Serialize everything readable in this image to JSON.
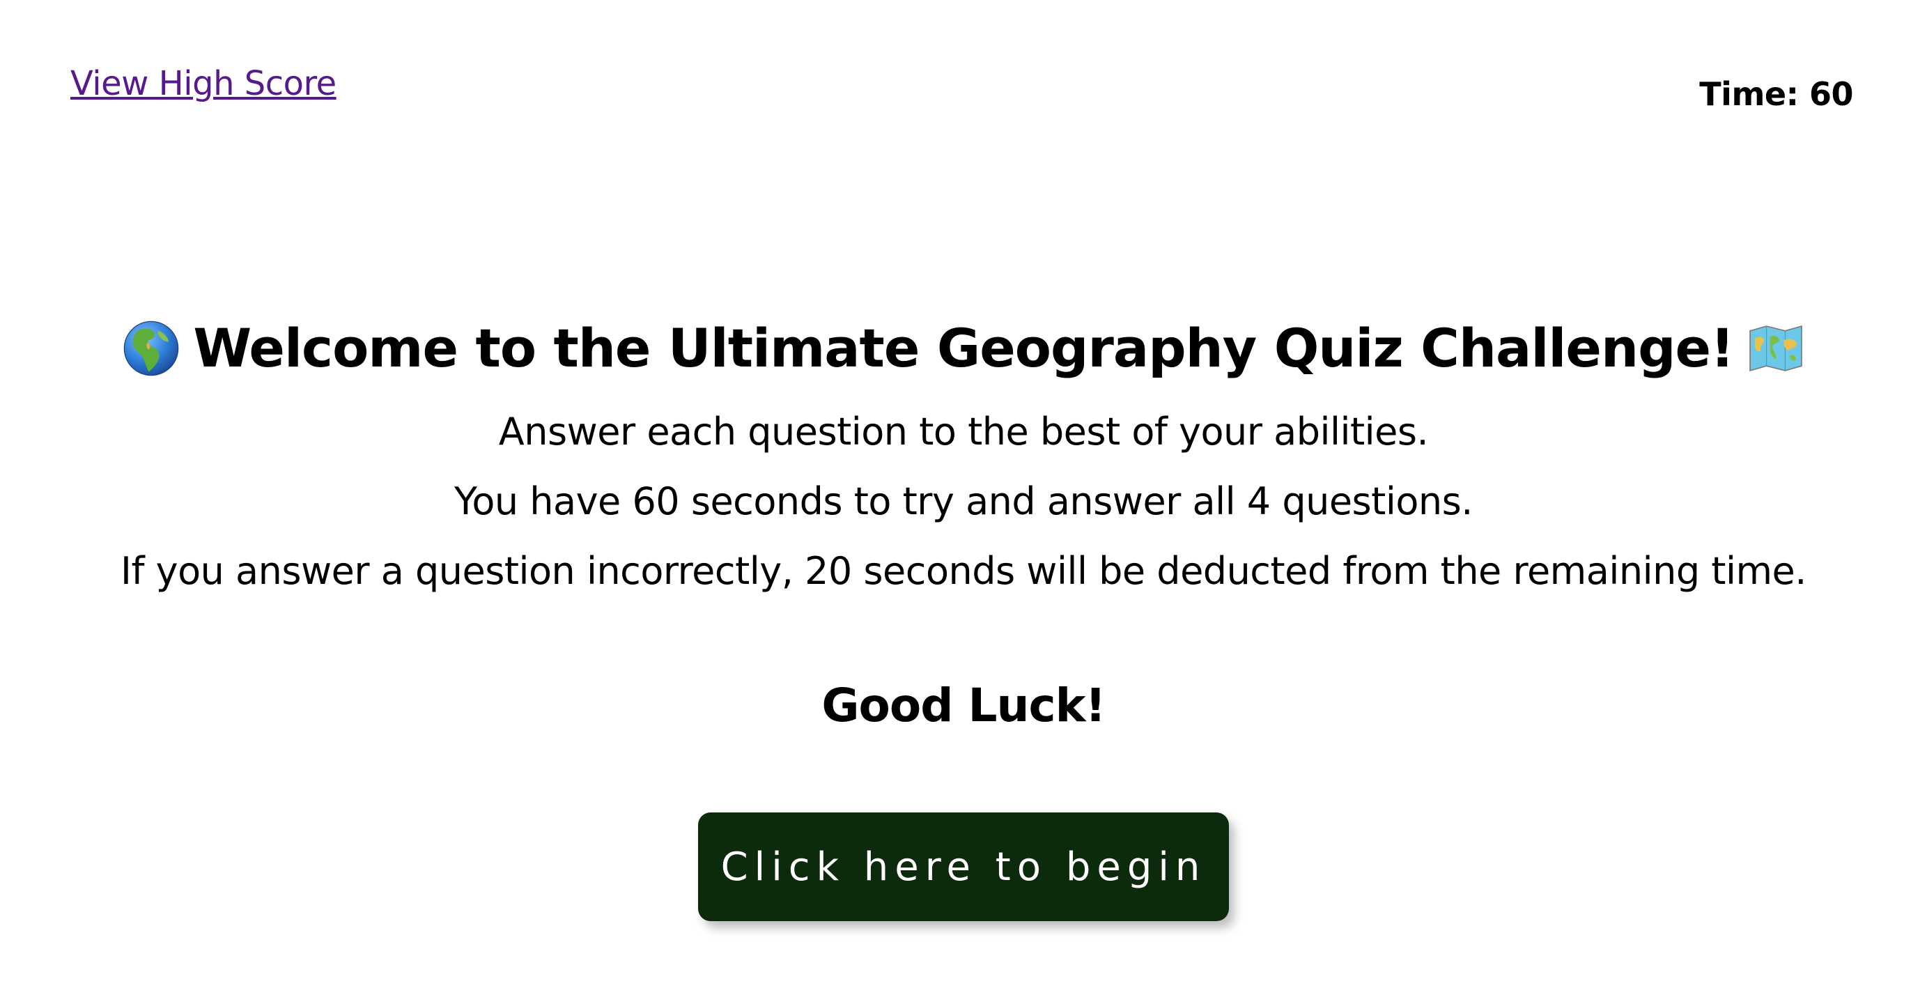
{
  "header": {
    "high_score_link": "View High Score",
    "timer_label": "Time:",
    "timer_value": "60"
  },
  "intro": {
    "title_prefix_icon": "globe-europe-africa-icon",
    "title": "Welcome to the Ultimate Geography Quiz Challenge!",
    "title_suffix_icon": "world-map-icon",
    "instructions": [
      "Answer each question to the best of your abilities.",
      "You have 60 seconds to try and answer all 4 questions.",
      "If you answer a question incorrectly, 20 seconds will be deducted from the remaining time."
    ],
    "good_luck": "Good Luck!",
    "begin_button": "Click here to begin"
  },
  "colors": {
    "link": "#551a8b",
    "button_background": "#0c2a0c",
    "button_text": "#ffffff",
    "text": "#000000",
    "background": "#ffffff"
  }
}
